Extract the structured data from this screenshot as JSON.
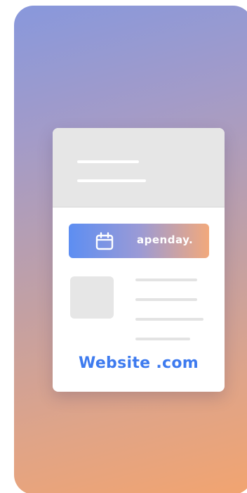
{
  "banner": {
    "brand_text": "apenday.",
    "icon": "calendar-icon",
    "gradient_colors": [
      "#5d8ef2",
      "#9a9ad6",
      "#f2a97c"
    ]
  },
  "site": {
    "label": "Website .com",
    "color": "#3e7bef"
  },
  "background": {
    "gradient_colors": [
      "#8898dc",
      "#c2a0a4",
      "#f2a470"
    ]
  },
  "icons": [
    "calendar-icon"
  ]
}
